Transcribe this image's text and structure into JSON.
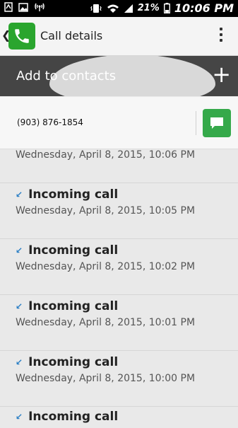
{
  "status_bar": {
    "battery": "21%",
    "time": "10:06 PM",
    "icons": [
      "notification-icon",
      "image-icon",
      "radio-icon",
      "vibrate-icon",
      "wifi-icon",
      "signal-icon",
      "battery-icon"
    ]
  },
  "action_bar": {
    "title": "Call details",
    "app_icon": "phone-icon"
  },
  "banner": {
    "label": "Add to contacts",
    "plus": "+"
  },
  "contact": {
    "number": "(903) 876-1854"
  },
  "calls": [
    {
      "type": "",
      "date": "Wednesday, April 8, 2015, 10:06 PM"
    },
    {
      "type": "Incoming call",
      "date": "Wednesday, April 8, 2015, 10:05 PM"
    },
    {
      "type": "Incoming call",
      "date": "Wednesday, April 8, 2015, 10:02 PM"
    },
    {
      "type": "Incoming call",
      "date": "Wednesday, April 8, 2015, 10:01 PM"
    },
    {
      "type": "Incoming call",
      "date": "Wednesday, April 8, 2015, 10:00 PM"
    },
    {
      "type": "Incoming call",
      "date": ""
    }
  ],
  "colors": {
    "accent_green": "#2aa52e",
    "incoming_arrow": "#2b7fc5"
  }
}
